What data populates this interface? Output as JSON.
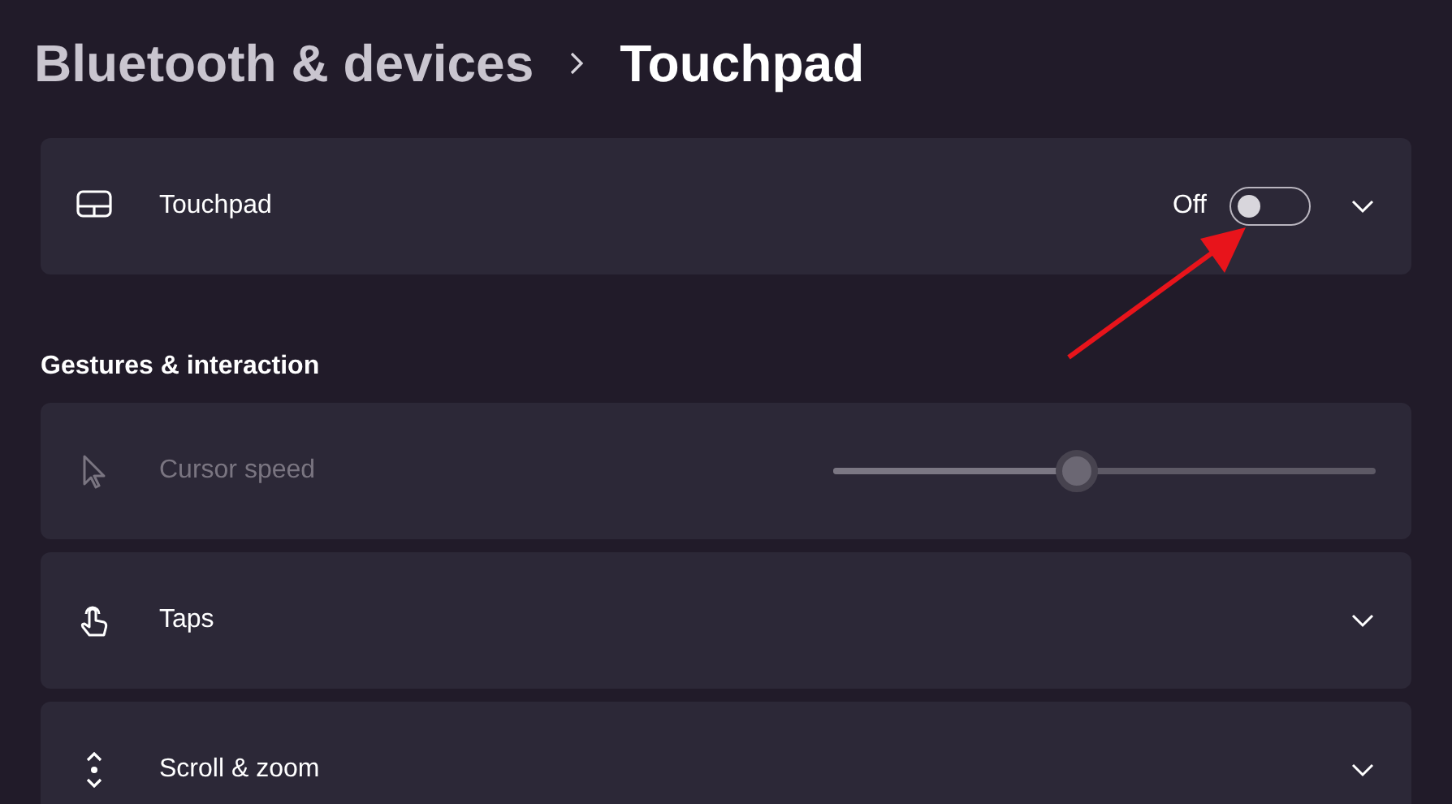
{
  "breadcrumb": [
    {
      "label": "Bluetooth & devices",
      "current": false
    },
    {
      "label": "Touchpad",
      "current": true
    }
  ],
  "touchpad": {
    "label": "Touchpad",
    "state_text": "Off",
    "on": false,
    "expanded": false
  },
  "section": {
    "title": "Gestures & interaction"
  },
  "settings": [
    {
      "kind": "slider",
      "label": "Cursor speed",
      "disabled": true,
      "level": 0.45
    },
    {
      "kind": "expander",
      "label": "Taps",
      "disabled": false,
      "expanded": false
    },
    {
      "kind": "expander",
      "label": "Scroll & zoom",
      "disabled": false,
      "expanded": false
    }
  ]
}
